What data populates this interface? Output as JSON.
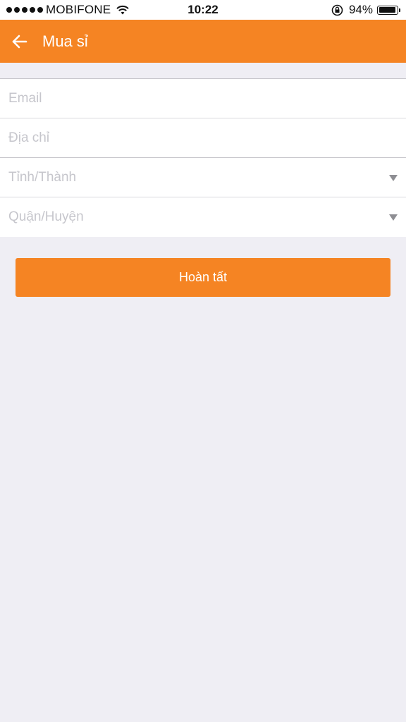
{
  "status_bar": {
    "carrier": "MOBIFONE",
    "time": "10:22",
    "battery_percent": "94%",
    "battery_level": 0.94,
    "signal_bars": 5,
    "icons": [
      "signal-dots-icon",
      "wifi-icon",
      "rotation-lock-icon",
      "battery-icon"
    ]
  },
  "header": {
    "title": "Mua sỉ",
    "back_icon": "arrow-left-icon",
    "background": "#f58423"
  },
  "form": {
    "email_placeholder": "Email",
    "email_value": "",
    "address_placeholder": "Địa chỉ",
    "address_value": "",
    "province_placeholder": "Tỉnh/Thành",
    "district_placeholder": "Quận/Huyện",
    "dropdown_icon": "caret-down-icon"
  },
  "submit": {
    "label": "Hoàn tất",
    "color": "#f58423"
  },
  "colors": {
    "accent": "#f58423",
    "background": "#efeef4",
    "placeholder": "#c6c6cc"
  }
}
